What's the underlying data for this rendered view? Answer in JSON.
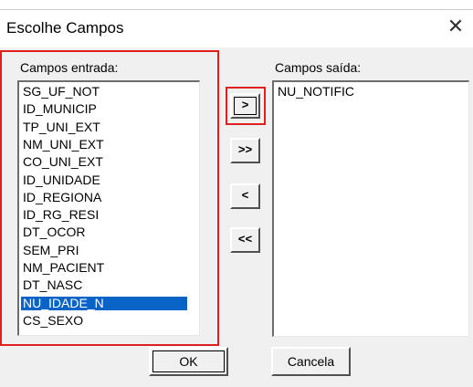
{
  "dialog": {
    "title": "Escolhe Campos"
  },
  "left": {
    "label": "Campos entrada:",
    "items": [
      "SG_UF_NOT",
      "ID_MUNICIP",
      "TP_UNI_EXT",
      "NM_UNI_EXT",
      "CO_UNI_EXT",
      "ID_UNIDADE",
      "ID_REGIONA",
      "ID_RG_RESI",
      "DT_OCOR",
      "SEM_PRI",
      "NM_PACIENT",
      "DT_NASC",
      "NU_IDADE_N",
      "CS_SEXO"
    ],
    "selected_index": 12
  },
  "right": {
    "label": "Campos saída:",
    "items": [
      "NU_NOTIFIC"
    ]
  },
  "buttons": {
    "add": ">",
    "add_all": ">>",
    "remove": "<",
    "remove_all": "<<",
    "ok": "OK",
    "cancel": "Cancela"
  },
  "colors": {
    "highlight": "#e02020",
    "selection": "#0a64c8"
  }
}
